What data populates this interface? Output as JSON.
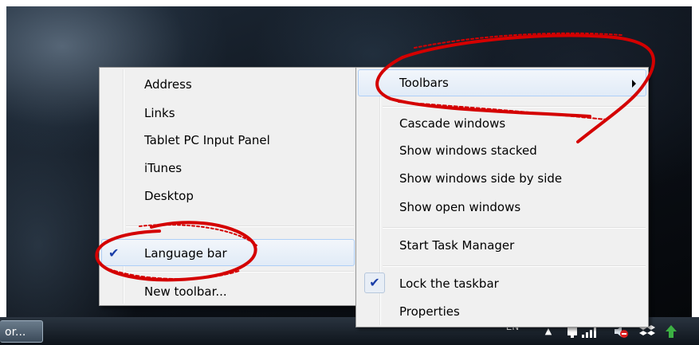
{
  "taskbar": {
    "task_button_label": "or...",
    "language": "EN"
  },
  "toolbars_submenu": {
    "items": [
      {
        "label": "Address",
        "checked": false
      },
      {
        "label": "Links",
        "checked": false
      },
      {
        "label": "Tablet PC Input Panel",
        "checked": false
      },
      {
        "label": "iTunes",
        "checked": false
      },
      {
        "label": "Desktop",
        "checked": false
      },
      {
        "label": "Language bar",
        "checked": true,
        "highlighted": true
      },
      {
        "label": "New toolbar...",
        "checked": false
      }
    ]
  },
  "taskbar_menu": {
    "toolbars_label": "Toolbars",
    "cascade_label": "Cascade windows",
    "stacked_label": "Show windows stacked",
    "side_by_side_label": "Show windows side by side",
    "open_windows_label": "Show open windows",
    "task_manager_label": "Start Task Manager",
    "lock_label": "Lock the taskbar",
    "lock_checked": true,
    "properties_label": "Properties"
  },
  "annotation": {
    "color": "#d40000"
  }
}
